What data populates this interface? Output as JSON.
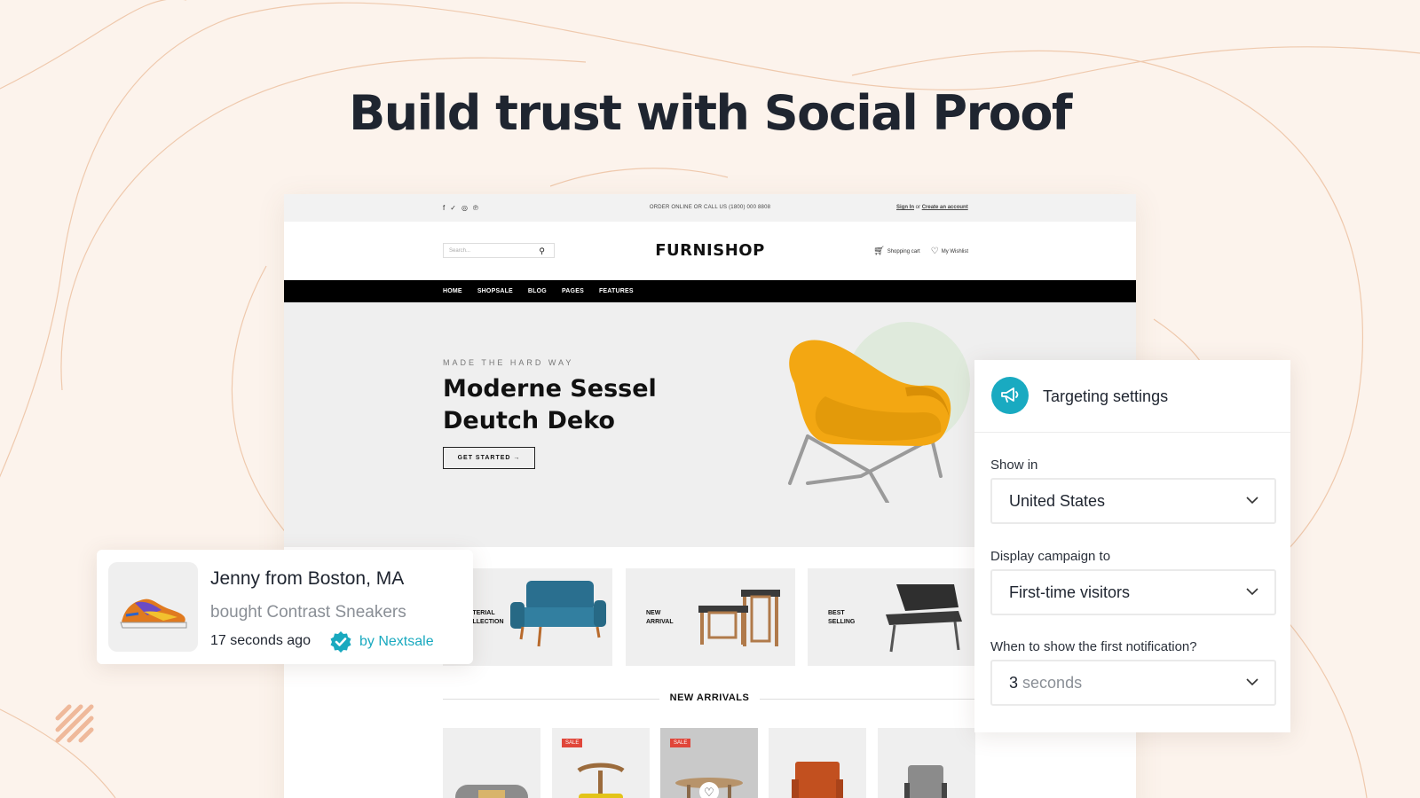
{
  "headline": "Build trust with Social Proof",
  "colors": {
    "background": "#fcf3ec",
    "accent": "#19aac1",
    "sale_badge": "#e0463a",
    "chair": "#f3a712"
  },
  "store": {
    "social_icons": [
      "facebook-icon",
      "twitter-icon",
      "instagram-icon",
      "pinterest-icon"
    ],
    "promo": "ORDER ONLINE OR CALL US (1800) 000 8808",
    "sign_in": "Sign In",
    "or": "or",
    "create_account": "Create an account",
    "search_placeholder": "Search...",
    "logo": "FURNISHOP",
    "cart": "Shopping cart",
    "wishlist": "My Wishlist",
    "nav": [
      "HOME",
      "SHOPSALE",
      "BLOG",
      "PAGES",
      "FEATURES"
    ],
    "hero": {
      "eyebrow": "MADE THE HARD WAY",
      "title_line1": "Moderne Sessel",
      "title_line2": "Deutch Deko",
      "cta": "GET STARTED →"
    },
    "categories": [
      {
        "line1": "MATERIAL",
        "line2": "COLLECTION"
      },
      {
        "line1": "NEW",
        "line2": "ARRIVAL"
      },
      {
        "line1": "BEST",
        "line2": "SELLING"
      }
    ],
    "new_arrivals": "NEW ARRIVALS",
    "sale_label": "SALE"
  },
  "toast": {
    "name": "Jenny from Boston, MA",
    "action": "bought Contrast Sneakers",
    "time": "17 seconds ago",
    "by": "by Nextsale"
  },
  "targeting": {
    "title": "Targeting settings",
    "show_in_label": "Show in",
    "show_in_value": "United States",
    "display_to_label": "Display campaign to",
    "display_to_value": "First-time visitors",
    "first_notif_label": "When to show the first notification?",
    "first_notif_number": "3",
    "first_notif_unit": "seconds"
  }
}
